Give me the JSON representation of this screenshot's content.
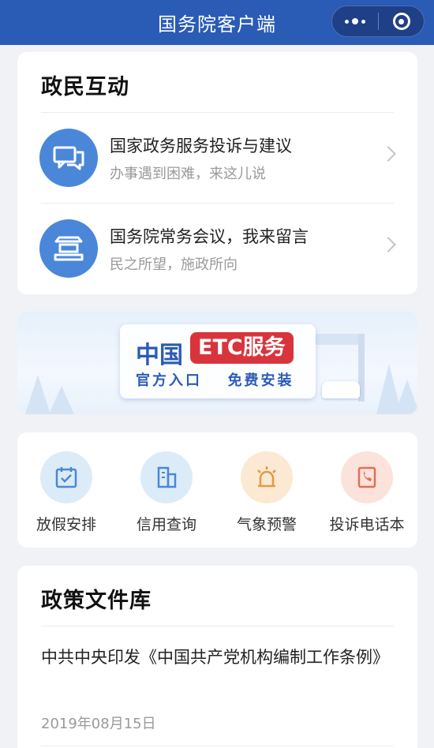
{
  "header": {
    "title": "国务院客户端",
    "more_icon": "more-dots-icon",
    "close_icon": "target-icon",
    "bg_color": "#2a5bb5"
  },
  "interaction": {
    "title": "政民互动",
    "items": [
      {
        "title": "国家政务服务投诉与建议",
        "subtitle": "办事遇到困难，来这儿说",
        "icon": "chat-bubbles-icon"
      },
      {
        "title": "国务院常务会议，我来留言",
        "subtitle": "民之所望，施政所向",
        "icon": "building-icon"
      }
    ]
  },
  "banner": {
    "brand": "中国",
    "badge": "ETC服务",
    "sub_left": "官方入口",
    "sub_right": "免费安装"
  },
  "quick": {
    "items": [
      {
        "label": "放假安排",
        "icon": "calendar-check-icon",
        "color": "#dcebf8",
        "fg": "#4a87d9"
      },
      {
        "label": "信用查询",
        "icon": "building-doc-icon",
        "color": "#dcebf8",
        "fg": "#4a87d9"
      },
      {
        "label": "气象预警",
        "icon": "alarm-light-icon",
        "color": "#fbe9d3",
        "fg": "#e29a48"
      },
      {
        "label": "投诉电话本",
        "icon": "phone-book-icon",
        "color": "#fbe2da",
        "fg": "#e06f58"
      }
    ]
  },
  "policy": {
    "title": "政策文件库",
    "article": "中共中央印发《中国共产党机构编制工作条例》",
    "date": "2019年08月15日"
  }
}
